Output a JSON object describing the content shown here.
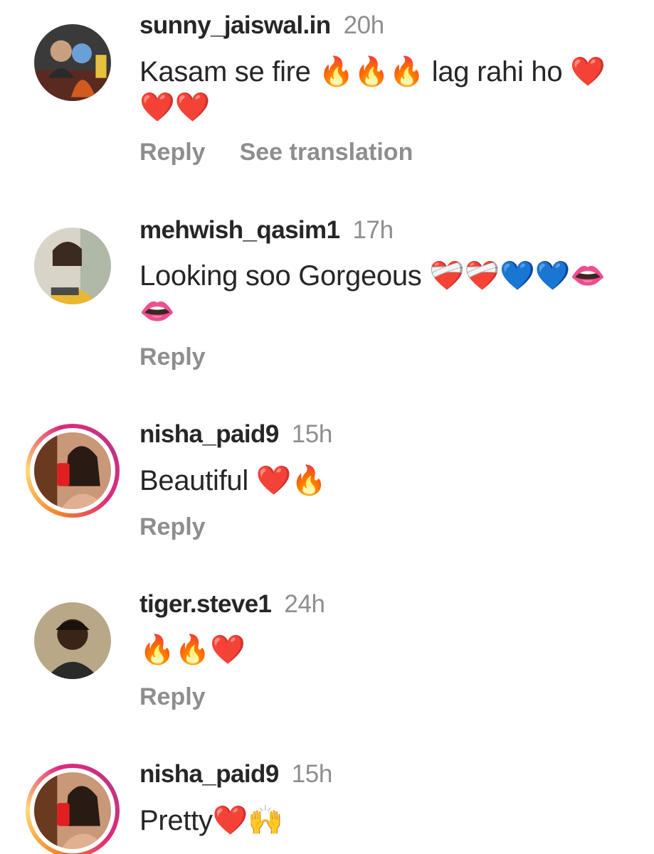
{
  "comments": [
    {
      "username": "sunny_jaiswal.in",
      "time": "20h",
      "text": "Kasam se fire 🔥🔥🔥 lag rahi ho ❤️❤️❤️",
      "reply_label": "Reply",
      "translate_label": "See translation",
      "avatar_icon": "profile-photo"
    },
    {
      "username": "mehwish_qasim1",
      "time": "17h",
      "text": "Looking soo Gorgeous ❤️‍🩹❤️‍🩹💙💙👄👄",
      "reply_label": "Reply",
      "avatar_icon": "profile-photo"
    },
    {
      "username": "nisha_paid9",
      "time": "15h",
      "text": "Beautiful ❤️🔥",
      "reply_label": "Reply",
      "avatar_icon": "profile-photo-with-story-ring"
    },
    {
      "username": "tiger.steve1",
      "time": "24h",
      "text": "🔥🔥❤️",
      "reply_label": "Reply",
      "avatar_icon": "profile-photo"
    },
    {
      "username": "nisha_paid9",
      "time": "15h",
      "text": "Pretty❤️🙌",
      "avatar_icon": "profile-photo-with-story-ring"
    }
  ],
  "colors": {
    "username": "#262626",
    "meta": "#8e8e8e",
    "story_ring_start": "#f58529",
    "story_ring_end": "#dd2a7b"
  }
}
